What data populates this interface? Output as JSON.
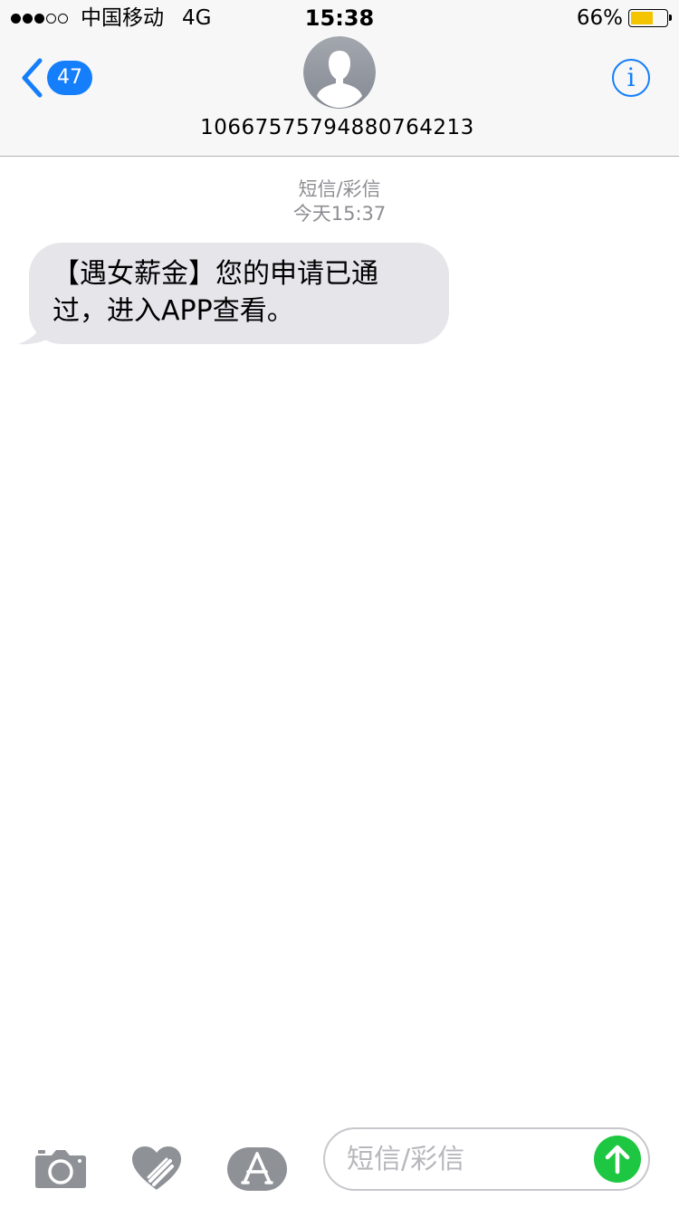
{
  "status_bar": {
    "signal_bars_filled": 3,
    "signal_bars_total": 5,
    "carrier": "中国移动",
    "network": "4G",
    "time": "15:38",
    "battery_percent": "66%",
    "battery_level": 0.66,
    "battery_color": "#f5c400"
  },
  "header": {
    "back_count": "47",
    "contact_number": "10667575794880764213 ",
    "info_label": "i"
  },
  "conversation": {
    "meta_type": "短信/彩信",
    "meta_time": "今天15:37",
    "messages": [
      {
        "direction": "incoming",
        "text": "【遇女薪金】您的申请已通过，进入APP查看。"
      }
    ]
  },
  "input_bar": {
    "placeholder": "短信/彩信",
    "icons": [
      "camera-icon",
      "digital-touch-icon",
      "app-store-icon"
    ],
    "send_color": "#1ec741"
  },
  "colors": {
    "accent": "#147efb",
    "bubble_incoming": "#e5e5ea",
    "meta_text": "#8e8e93"
  }
}
